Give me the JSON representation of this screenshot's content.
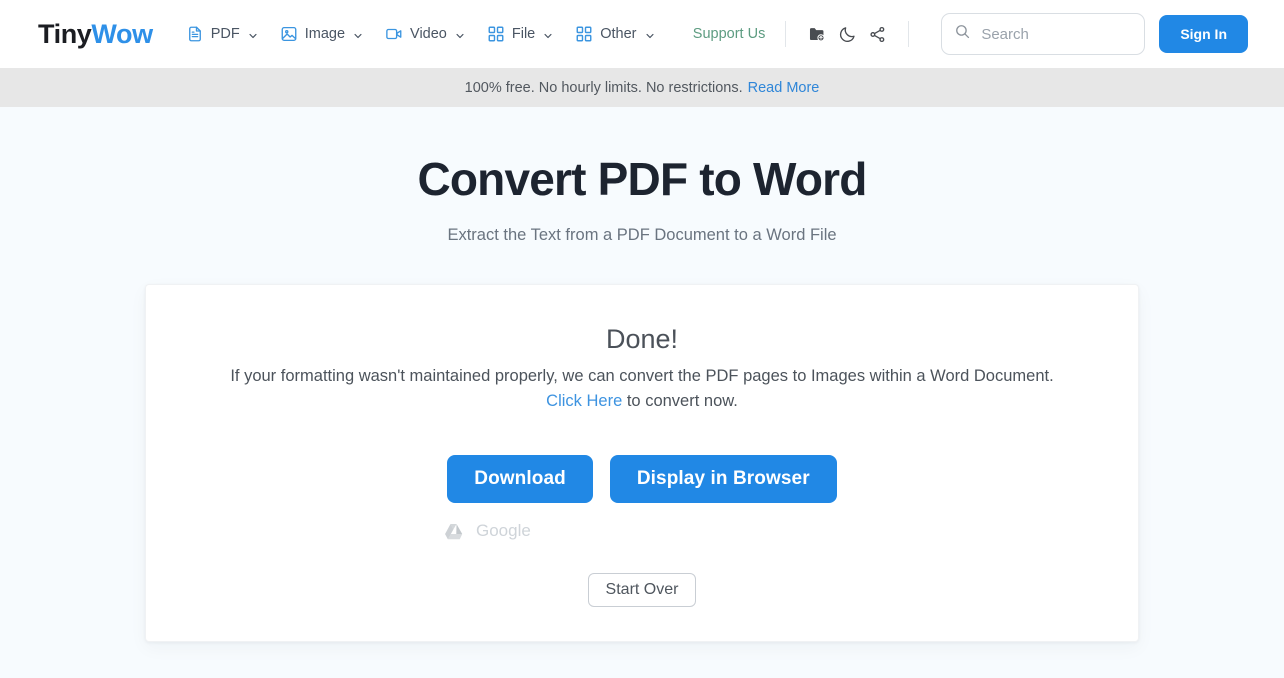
{
  "header": {
    "logo": {
      "part1": "Tiny",
      "part2": "Wow"
    },
    "nav": [
      {
        "label": "PDF",
        "icon": "pdf-document-icon"
      },
      {
        "label": "Image",
        "icon": "image-icon"
      },
      {
        "label": "Video",
        "icon": "video-camera-icon"
      },
      {
        "label": "File",
        "icon": "grid-file-icon"
      },
      {
        "label": "Other",
        "icon": "grid-other-icon"
      }
    ],
    "support_label": "Support Us",
    "icons": [
      {
        "name": "folder-upload-icon"
      },
      {
        "name": "moon-dark-mode-icon"
      },
      {
        "name": "share-icon"
      }
    ],
    "search": {
      "placeholder": "Search",
      "value": ""
    },
    "signin_label": "Sign In",
    "accent_color": "#2188e5",
    "support_color": "#5d9c81"
  },
  "banner": {
    "text": "100% free. No hourly limits. No restrictions.",
    "link_label": "Read More",
    "background": "#e7e7e7"
  },
  "hero": {
    "title": "Convert PDF to Word",
    "subtitle": "Extract the Text from a PDF Document to a Word File"
  },
  "card": {
    "status": "Done!",
    "description_before": "If your formatting wasn't maintained properly, we can convert the PDF pages to Images within a Word Document.",
    "link_label": "Click Here",
    "description_after": " to convert now.",
    "buttons": {
      "download": "Download",
      "display": "Display in Browser",
      "start_over": "Start Over"
    },
    "cloud": {
      "label": "Google",
      "icon": "google-drive-icon"
    }
  }
}
